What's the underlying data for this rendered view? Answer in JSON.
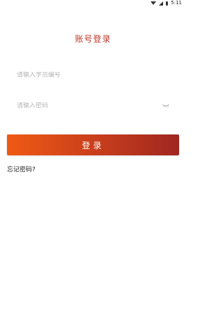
{
  "status_bar": {
    "time": "5:11"
  },
  "login": {
    "title": "账号登录",
    "student_id_placeholder": "请输入学员编号",
    "password_placeholder": "请输入密码",
    "submit_label": "登录",
    "forgot_password": "忘记密码?"
  },
  "colors": {
    "title": "#c0392b",
    "button_start": "#ef5a14",
    "button_end": "#9f2620",
    "placeholder": "#b5b5b5"
  },
  "icons": {
    "password_visibility": "eye-closed-icon"
  }
}
